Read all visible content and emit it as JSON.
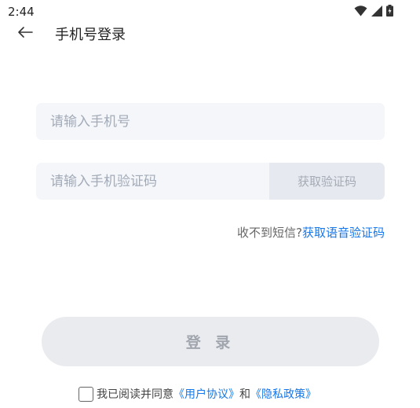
{
  "status_bar": {
    "time": "2:44",
    "icons": [
      "wifi-icon",
      "signal-icon",
      "battery-icon"
    ]
  },
  "app_bar": {
    "back_icon": "arrow-left-icon",
    "title": "手机号登录"
  },
  "form": {
    "phone": {
      "placeholder": "请输入手机号",
      "value": ""
    },
    "code": {
      "placeholder": "请输入手机验证码",
      "value": ""
    },
    "get_code_label": "获取验证码",
    "sms_hint": "收不到短信?",
    "voice_code_link": "获取语音验证码",
    "login_label": "登 录"
  },
  "agreement": {
    "prefix": "我已阅读并同意",
    "user_agreement": "《用户协议》",
    "conjunction": "和",
    "privacy_policy": "《隐私政策》",
    "checked": false
  },
  "colors": {
    "accent": "#1677e8",
    "field_bg": "#f4f6fa",
    "disabled_button_bg": "#e9ebef"
  }
}
